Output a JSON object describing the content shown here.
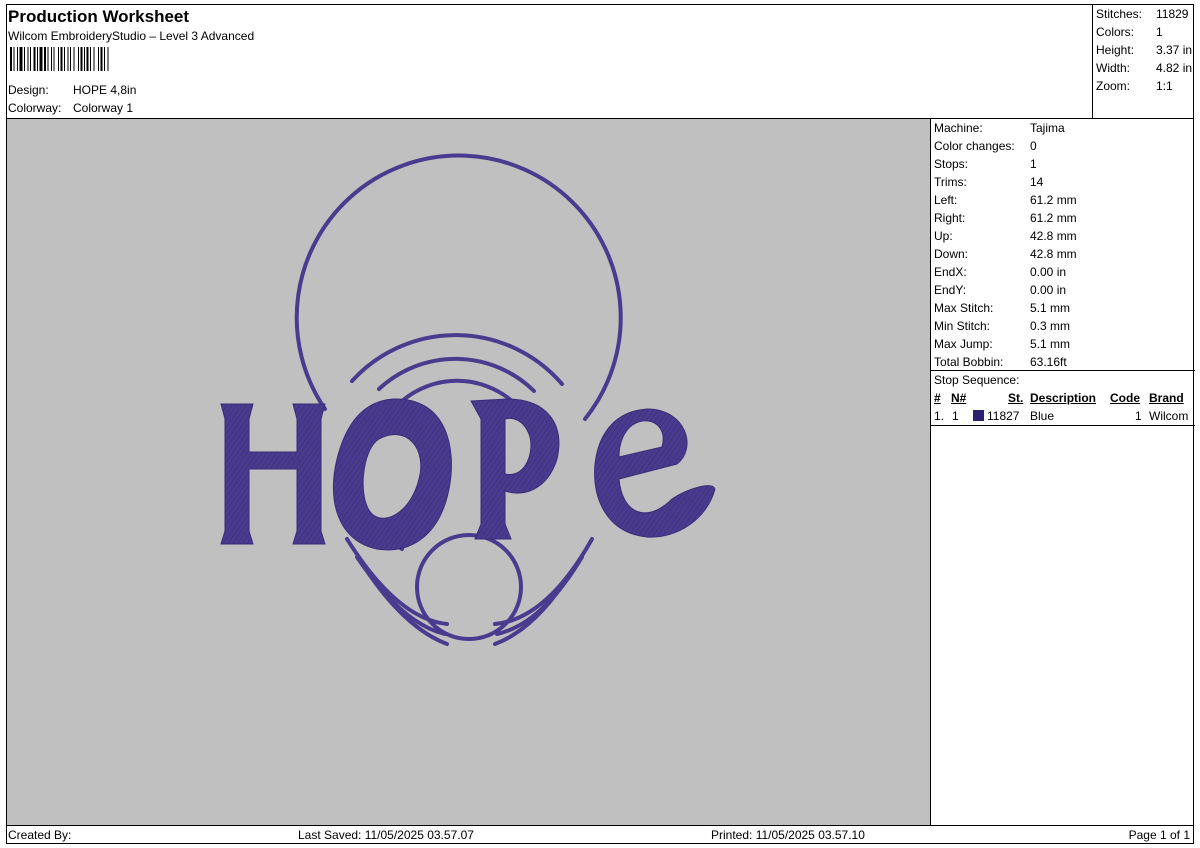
{
  "header": {
    "title": "Production Worksheet",
    "subtitle": "Wilcom EmbroideryStudio – Level 3 Advanced",
    "design_label": "Design:",
    "design_value": "HOPE 4,8in",
    "colorway_label": "Colorway:",
    "colorway_value": "Colorway 1"
  },
  "stats": [
    {
      "label": "Stitches:",
      "value": "11829"
    },
    {
      "label": "Colors:",
      "value": "1"
    },
    {
      "label": "Height:",
      "value": "3.37 in"
    },
    {
      "label": "Width:",
      "value": "4.82 in"
    },
    {
      "label": "Zoom:",
      "value": "1:1"
    }
  ],
  "machine_info": [
    {
      "label": "Machine:",
      "value": "Tajima"
    },
    {
      "label": "Color changes:",
      "value": "0"
    },
    {
      "label": "Stops:",
      "value": "1"
    },
    {
      "label": "Trims:",
      "value": "14"
    },
    {
      "label": "Left:",
      "value": "61.2 mm"
    },
    {
      "label": "Right:",
      "value": "61.2 mm"
    },
    {
      "label": "Up:",
      "value": "42.8 mm"
    },
    {
      "label": "Down:",
      "value": "42.8 mm"
    },
    {
      "label": "EndX:",
      "value": "0.00 in"
    },
    {
      "label": "EndY:",
      "value": "0.00 in"
    },
    {
      "label": "Max Stitch:",
      "value": "5.1 mm"
    },
    {
      "label": "Min Stitch:",
      "value": "0.3 mm"
    },
    {
      "label": "Max Jump:",
      "value": "5.1 mm"
    },
    {
      "label": "Total Bobbin:",
      "value": "63.16ft"
    }
  ],
  "stop_sequence": {
    "title": "Stop Sequence:",
    "columns": {
      "num": "#",
      "n": "N#",
      "st": "St.",
      "desc": "Description",
      "code": "Code",
      "brand": "Brand"
    },
    "rows": [
      {
        "num": "1.",
        "n": "1",
        "st": "11827",
        "desc": "Blue",
        "code": "1",
        "brand": "Wilcom",
        "color": "#29206e"
      }
    ]
  },
  "design": {
    "text": "HOPE",
    "thread_color": "#4b3b8f",
    "background_color": "#c0c0c0"
  },
  "footer": {
    "created_by": "Created By:",
    "last_saved": "Last Saved: 11/05/2025 03.57.07",
    "printed": "Printed: 11/05/2025 03.57.10",
    "page": "Page 1 of 1"
  }
}
